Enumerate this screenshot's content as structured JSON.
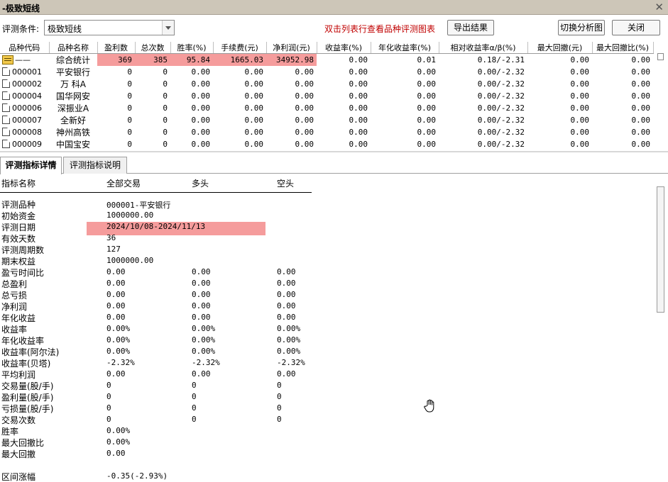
{
  "window": {
    "title": "-极致短线",
    "close_glyph": "✕"
  },
  "toolbar": {
    "label": "评测条件:",
    "combo_value": "极致短线",
    "hint": "双击列表行查看品种评测图表",
    "export_label": "导出结果",
    "switch_label": "切换分析图",
    "close_label": "关闭"
  },
  "table": {
    "columns": [
      "品种代码",
      "品种名称",
      "盈利数",
      "总次数",
      "胜率(%)",
      "手续费(元)",
      "净利润(元)",
      "收益率(%)",
      "年化收益率(%)",
      "相对收益率α/β(%)",
      "最大回撤(元)",
      "最大回撤比(%)"
    ],
    "summary": {
      "code": "——",
      "name": "综合统计",
      "win": "369",
      "total": "385",
      "winrate": "95.84",
      "fee": "1665.03",
      "profit": "34952.98",
      "ret": "0.00",
      "annual": "0.01",
      "relative": "0.18/-2.31",
      "maxdd": "0.00",
      "maxddr": "0.00"
    },
    "rows": [
      {
        "code": "000001",
        "name": "平安银行",
        "win": "0",
        "total": "0",
        "winrate": "0.00",
        "fee": "0.00",
        "profit": "0.00",
        "ret": "0.00",
        "annual": "0.00",
        "relative": "0.00/-2.32",
        "maxdd": "0.00",
        "maxddr": "0.00"
      },
      {
        "code": "000002",
        "name": "万 科A",
        "win": "0",
        "total": "0",
        "winrate": "0.00",
        "fee": "0.00",
        "profit": "0.00",
        "ret": "0.00",
        "annual": "0.00",
        "relative": "0.00/-2.32",
        "maxdd": "0.00",
        "maxddr": "0.00"
      },
      {
        "code": "000004",
        "name": "国华网安",
        "win": "0",
        "total": "0",
        "winrate": "0.00",
        "fee": "0.00",
        "profit": "0.00",
        "ret": "0.00",
        "annual": "0.00",
        "relative": "0.00/-2.32",
        "maxdd": "0.00",
        "maxddr": "0.00"
      },
      {
        "code": "000006",
        "name": "深振业A",
        "win": "0",
        "total": "0",
        "winrate": "0.00",
        "fee": "0.00",
        "profit": "0.00",
        "ret": "0.00",
        "annual": "0.00",
        "relative": "0.00/-2.32",
        "maxdd": "0.00",
        "maxddr": "0.00"
      },
      {
        "code": "000007",
        "name": "全新好",
        "win": "0",
        "total": "0",
        "winrate": "0.00",
        "fee": "0.00",
        "profit": "0.00",
        "ret": "0.00",
        "annual": "0.00",
        "relative": "0.00/-2.32",
        "maxdd": "0.00",
        "maxddr": "0.00"
      },
      {
        "code": "000008",
        "name": "神州高铁",
        "win": "0",
        "total": "0",
        "winrate": "0.00",
        "fee": "0.00",
        "profit": "0.00",
        "ret": "0.00",
        "annual": "0.00",
        "relative": "0.00/-2.32",
        "maxdd": "0.00",
        "maxddr": "0.00"
      },
      {
        "code": "000009",
        "name": "中国宝安",
        "win": "0",
        "total": "0",
        "winrate": "0.00",
        "fee": "0.00",
        "profit": "0.00",
        "ret": "0.00",
        "annual": "0.00",
        "relative": "0.00/-2.32",
        "maxdd": "0.00",
        "maxddr": "0.00"
      }
    ]
  },
  "tabs": [
    "评测指标详情",
    "评测指标说明"
  ],
  "detail": {
    "headers": {
      "name": "指标名称",
      "all": "全部交易",
      "long": "多头",
      "short": "空头"
    },
    "rows": [
      {
        "k": "评测品种",
        "v1": "000001-平安银行",
        "v2": "",
        "v3": ""
      },
      {
        "k": "初始资金",
        "v1": "1000000.00",
        "v2": "",
        "v3": ""
      },
      {
        "k": "评测日期",
        "v1": "2024/10/08-2024/11/13",
        "v2": "",
        "v3": ""
      },
      {
        "k": "有效天数",
        "v1": "36",
        "v2": "",
        "v3": ""
      },
      {
        "k": "评测周期数",
        "v1": "127",
        "v2": "",
        "v3": ""
      },
      {
        "k": "期末权益",
        "v1": "1000000.00",
        "v2": "",
        "v3": ""
      },
      {
        "k": "盈亏时间比",
        "v1": "0.00",
        "v2": "0.00",
        "v3": "0.00"
      },
      {
        "k": "总盈利",
        "v1": "0.00",
        "v2": "0.00",
        "v3": "0.00"
      },
      {
        "k": "总亏损",
        "v1": "0.00",
        "v2": "0.00",
        "v3": "0.00"
      },
      {
        "k": "净利润",
        "v1": "0.00",
        "v2": "0.00",
        "v3": "0.00"
      },
      {
        "k": "年化收益",
        "v1": "0.00",
        "v2": "0.00",
        "v3": "0.00"
      },
      {
        "k": "收益率",
        "v1": "0.00%",
        "v2": "0.00%",
        "v3": "0.00%"
      },
      {
        "k": "年化收益率",
        "v1": "0.00%",
        "v2": "0.00%",
        "v3": "0.00%"
      },
      {
        "k": "收益率(阿尔法)",
        "v1": "0.00%",
        "v2": "0.00%",
        "v3": "0.00%"
      },
      {
        "k": "收益率(贝塔)",
        "v1": "-2.32%",
        "v2": "-2.32%",
        "v3": "-2.32%"
      },
      {
        "k": "平均利润",
        "v1": "0.00",
        "v2": "0.00",
        "v3": "0.00"
      },
      {
        "k": "交易量(股/手)",
        "v1": "0",
        "v2": "0",
        "v3": "0"
      },
      {
        "k": "盈利量(股/手)",
        "v1": "0",
        "v2": "0",
        "v3": "0"
      },
      {
        "k": "亏损量(股/手)",
        "v1": "0",
        "v2": "0",
        "v3": "0"
      },
      {
        "k": "交易次数",
        "v1": "0",
        "v2": "0",
        "v3": "0"
      },
      {
        "k": "胜率",
        "v1": "0.00%",
        "v2": "",
        "v3": ""
      },
      {
        "k": "最大回撤比",
        "v1": "0.00%",
        "v2": "",
        "v3": ""
      },
      {
        "k": "最大回撤",
        "v1": "0.00",
        "v2": "",
        "v3": ""
      },
      {
        "k": "",
        "v1": "",
        "v2": "",
        "v3": ""
      },
      {
        "k": "区间涨幅",
        "v1": "-0.35(-2.93%)",
        "v2": "",
        "v3": ""
      }
    ]
  },
  "colors": {
    "highlight": "#f59c9c",
    "hint": "#c00000",
    "titlebar": "#cdc6b8"
  }
}
